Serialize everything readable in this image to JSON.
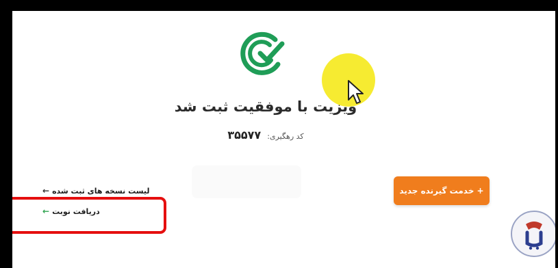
{
  "success": {
    "title": "ویزیت با موفقیت ثبت شد",
    "tracking_label": "کد رهگیری:",
    "tracking_code": "۳۵۵۷۷"
  },
  "actions": {
    "new_patient": "+ خدمت گیرنده جدید",
    "prescriptions_list": "لیست نسخه های ثبت شده",
    "get_turn": "دریافت نوبت"
  },
  "icons": {
    "success": "check-circle-icon",
    "arrow": "arrow-left-icon",
    "cursor": "mouse-pointer-icon",
    "watermark": "channel-logo-icon"
  },
  "colors": {
    "success_green": "#1f9d57",
    "accent_orange": "#f07d1d",
    "highlight_red": "#e50f0f",
    "cursor_spot": "#f5e814"
  }
}
